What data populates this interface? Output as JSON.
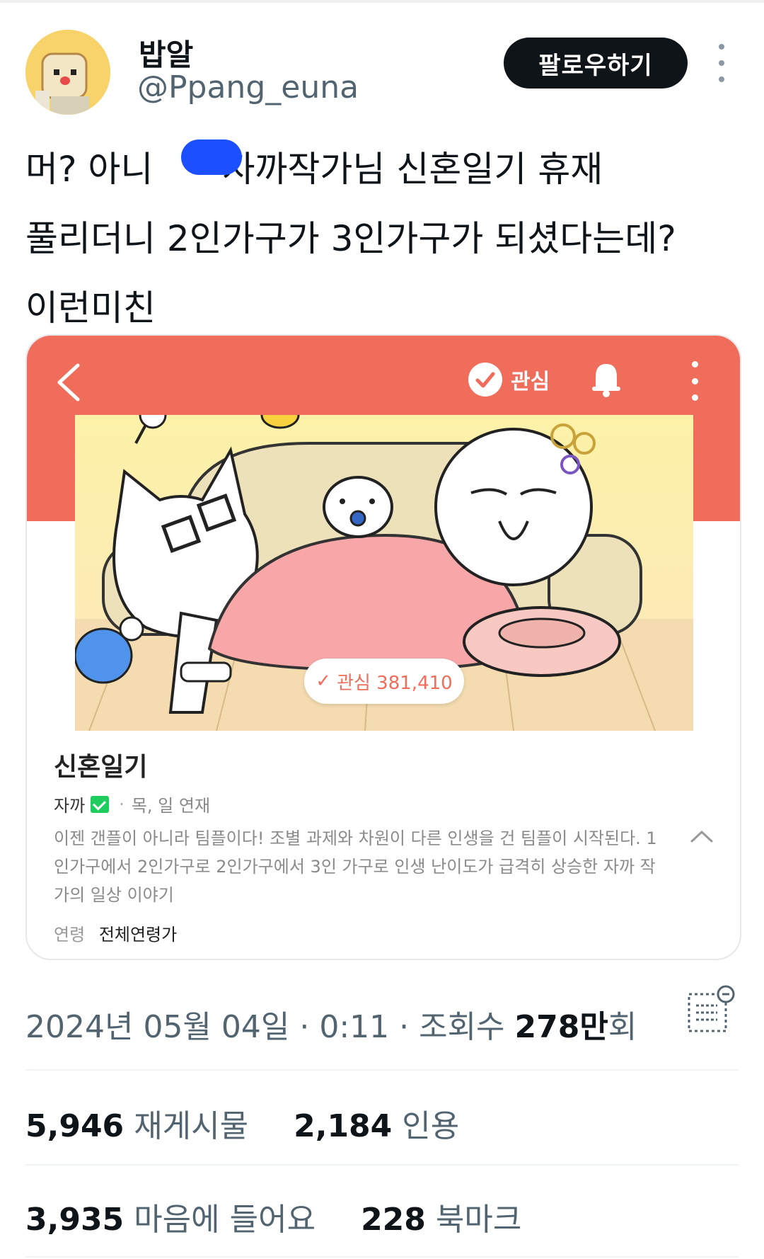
{
  "author": {
    "name": "밥알",
    "handle": "@Ppang_euna",
    "follow_label": "팔로우하기"
  },
  "tweet": {
    "line1_before": "머? 아니",
    "line1_after": "자까작가님 신혼일기 휴재",
    "line2": "풀리더니 2인가구가 3인가구가 되셨다는데?",
    "line3": "이런미친"
  },
  "card": {
    "fav_label": "관심",
    "fav_count_label": "관심 381,410",
    "title": "신혼일기",
    "author": "자까",
    "schedule": "목, 일 연재",
    "description": "이젠 갠플이 아니라 팀플이다! 조별 과제와 차원이 다른 인생을 건 팀플이 시작된다. 1인가구에서 2인가구로 2인가구에서 3인 가구로 인생 난이도가 급격히 상승한 자까 작가의 일상 이야기",
    "age_label": "연령",
    "age_value": "전체연령가",
    "icons": [
      "back-icon",
      "check-circle-icon",
      "bell-icon",
      "more-icon",
      "collapse-chevron-icon"
    ],
    "band_color": "#f06d5c"
  },
  "post_meta": {
    "date": "2024년 05월 04일 · 0:11 · 조회수 ",
    "views": "278만",
    "views_suffix": "회"
  },
  "stats": {
    "retweets": "5,946",
    "retweets_label": "재게시물",
    "quotes": "2,184",
    "quotes_label": "인용",
    "likes": "3,935",
    "likes_label": "마음에 들어요",
    "bookmarks": "228",
    "bookmarks_label": "북마크"
  }
}
